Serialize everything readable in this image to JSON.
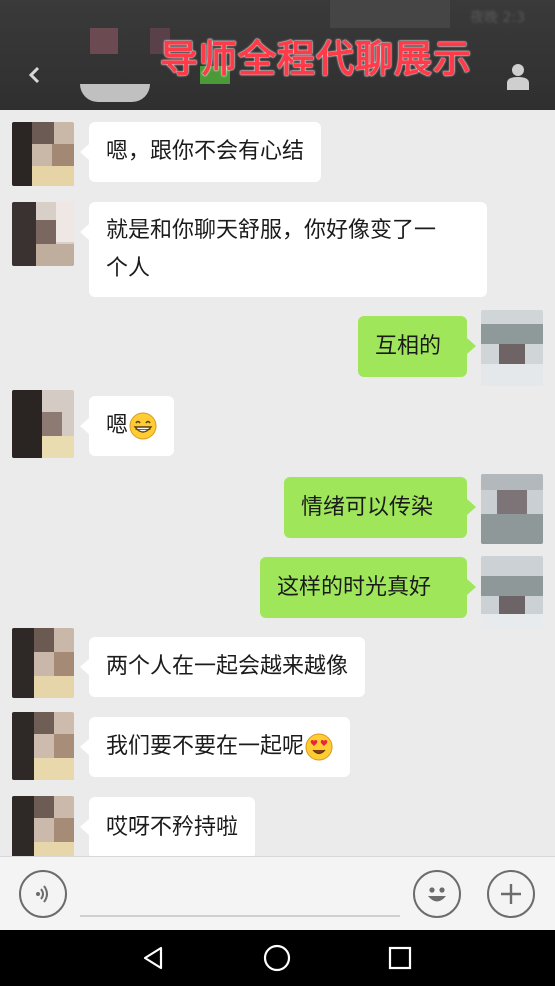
{
  "header": {
    "title": "导师全程代聊展示",
    "status_text": "夜晚 2:3"
  },
  "messages": [
    {
      "side": "left",
      "text": "嗯，跟你不会有心结"
    },
    {
      "side": "left",
      "line1": "就是和你聊天舒服，你好像变了一",
      "line2": "个人"
    },
    {
      "side": "right",
      "text": "互相的"
    },
    {
      "side": "left",
      "text": "嗯",
      "emoji": "grinning-face-icon"
    },
    {
      "side": "right",
      "text": "情绪可以传染"
    },
    {
      "side": "right",
      "text": "这样的时光真好"
    },
    {
      "side": "left",
      "text": "两个人在一起会越来越像"
    },
    {
      "side": "left",
      "text": "我们要不要在一起呢",
      "emoji": "heart-eyes-icon"
    },
    {
      "side": "left",
      "text": "哎呀不矜持啦"
    }
  ],
  "input_bar": {
    "voice_icon": "voice-icon",
    "emoji_icon": "smiley-icon",
    "add_icon": "plus-icon"
  },
  "nav_bar": {
    "back_icon": "triangle-back-icon",
    "home_icon": "circle-home-icon",
    "recent_icon": "square-recents-icon"
  },
  "colors": {
    "header_bg": "#2f2f2f",
    "title": "#ff3b4a",
    "chat_bg": "#ebebeb",
    "bubble_left": "#ffffff",
    "bubble_right": "#9fe65b"
  }
}
